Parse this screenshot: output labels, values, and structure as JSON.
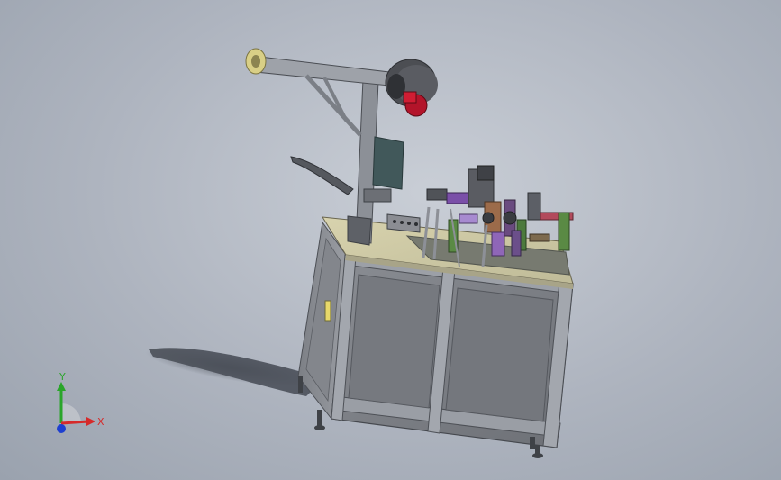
{
  "viewport": {
    "background": "#aeb4bf"
  },
  "triad": {
    "x_label": "X",
    "y_label": "Y",
    "x_color": "#d62a2a",
    "y_color": "#2aa52a",
    "z_color": "#1d3fd0"
  }
}
